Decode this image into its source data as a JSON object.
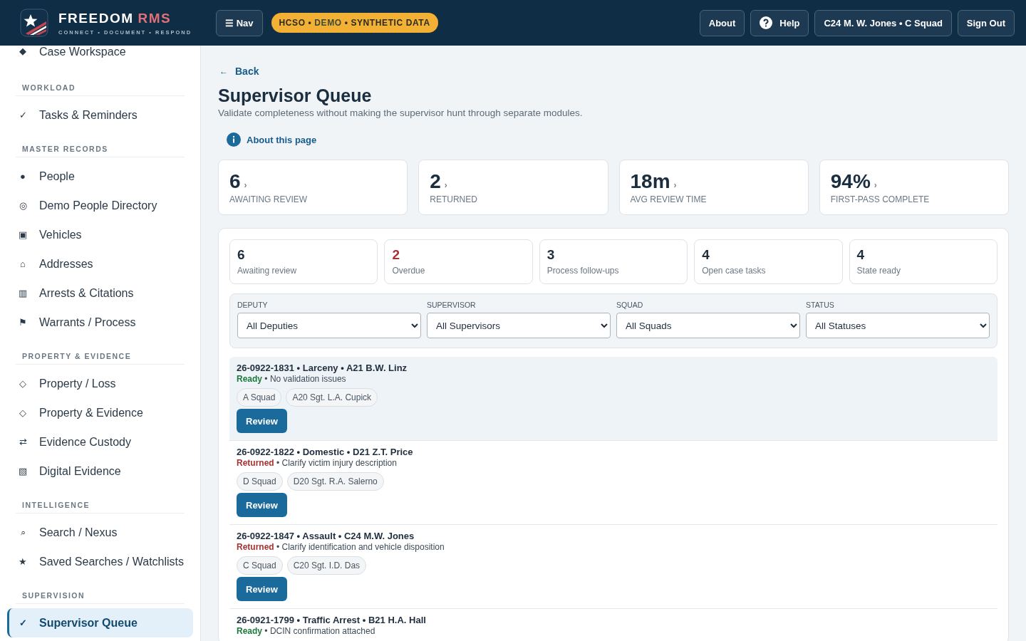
{
  "header": {
    "brand": "FREEDOM",
    "brand_accent": "RMS",
    "tagline": "CONNECT • DOCUMENT • RESPOND",
    "nav_button": "☰ Nav",
    "badge": {
      "parts": [
        "HCSO • ",
        "DEMO",
        " • SYNTHETIC DATA"
      ]
    },
    "buttons": [
      {
        "label": "About",
        "kind": "plain"
      },
      {
        "label": "Help",
        "kind": "help"
      },
      {
        "label": "C24 M. W. Jones • C Squad",
        "kind": "plain"
      },
      {
        "label": "Sign Out",
        "kind": "plain"
      }
    ]
  },
  "sidebar": {
    "sections": [
      {
        "items": [
          {
            "icon": "◆",
            "label": "Case Workspace",
            "selected": false
          }
        ]
      },
      {
        "title": "WORKLOAD",
        "items": [
          {
            "icon": "✓",
            "label": "Tasks & Reminders",
            "selected": false
          }
        ]
      },
      {
        "title": "MASTER RECORDS",
        "items": [
          {
            "icon": "●",
            "label": "People",
            "selected": false
          },
          {
            "icon": "◎",
            "label": "Demo People Directory",
            "selected": false
          },
          {
            "icon": "▣",
            "label": "Vehicles",
            "selected": false
          },
          {
            "icon": "⌂",
            "label": "Addresses",
            "selected": false
          },
          {
            "icon": "▥",
            "label": "Arrests & Citations",
            "selected": false
          },
          {
            "icon": "⚑",
            "label": "Warrants / Process",
            "selected": false
          }
        ]
      },
      {
        "title": "PROPERTY & EVIDENCE",
        "items": [
          {
            "icon": "◇",
            "label": "Property / Loss",
            "selected": false
          },
          {
            "icon": "◇",
            "label": "Property & Evidence",
            "selected": false
          },
          {
            "icon": "⇄",
            "label": "Evidence Custody",
            "selected": false
          },
          {
            "icon": "▧",
            "label": "Digital Evidence",
            "selected": false
          }
        ]
      },
      {
        "title": "INTELLIGENCE",
        "items": [
          {
            "icon": "⌕",
            "label": "Search / Nexus",
            "selected": false
          },
          {
            "icon": "★",
            "label": "Saved Searches / Watchlists",
            "selected": false
          }
        ]
      },
      {
        "title": "SUPERVISION",
        "items": [
          {
            "icon": "✓",
            "label": "Supervisor Queue",
            "selected": true
          }
        ]
      }
    ]
  },
  "page": {
    "back": "Back",
    "arrow": "←",
    "title": "Supervisor Queue",
    "subtitle": "Validate completeness without making the supervisor hunt through separate modules.",
    "about": "About this page"
  },
  "kpis": [
    {
      "value": "6",
      "chevron": "›",
      "label": "AWAITING REVIEW"
    },
    {
      "value": "2",
      "chevron": "›",
      "label": "RETURNED"
    },
    {
      "value": "18m",
      "chevron": "›",
      "label": "AVG REVIEW TIME"
    },
    {
      "value": "94%",
      "chevron": "›",
      "label": "FIRST-PASS COMPLETE"
    }
  ],
  "summary": [
    {
      "value": "6",
      "label": "Awaiting review",
      "kind": "normal"
    },
    {
      "value": "2",
      "label": "Overdue",
      "kind": "alert"
    },
    {
      "value": "3",
      "label": "Process follow-ups",
      "kind": "normal"
    },
    {
      "value": "4",
      "label": "Open case tasks",
      "kind": "normal"
    },
    {
      "value": "4",
      "label": "State ready",
      "kind": "normal"
    }
  ],
  "filters": [
    {
      "label": "DEPUTY",
      "value": "All Deputies"
    },
    {
      "label": "SUPERVISOR",
      "value": "All Supervisors"
    },
    {
      "label": "SQUAD",
      "value": "All Squads"
    },
    {
      "label": "STATUS",
      "value": "All Statuses"
    }
  ],
  "queue": [
    {
      "title": "26-0922-1831 • Larceny • A21 B.W. Linz",
      "status": {
        "label": "Ready",
        "color": "#1d7a3d"
      },
      "note": " • No validation issues",
      "tags": [
        "A Squad",
        "A20 Sgt. L.A. Cupick"
      ],
      "action": "Review",
      "selected": true
    },
    {
      "title": "26-0922-1822 • Domestic • D21 Z.T. Price",
      "status": {
        "label": "Returned",
        "color": "#a83232"
      },
      "note": " • Clarify victim injury description",
      "tags": [
        "D Squad",
        "D20 Sgt. R.A. Salerno"
      ],
      "action": "Review",
      "selected": false
    },
    {
      "title": "26-0922-1847 • Assault • C24 M.W. Jones",
      "status": {
        "label": "Returned",
        "color": "#a83232"
      },
      "note": " • Clarify identification and vehicle disposition",
      "tags": [
        "C Squad",
        "C20 Sgt. I.D. Das"
      ],
      "action": "Review",
      "selected": false
    },
    {
      "title": "26-0921-1799 • Traffic Arrest • B21 H.A. Hall",
      "status": {
        "label": "Ready",
        "color": "#1d7a3d"
      },
      "note": " • DCIN confirmation attached",
      "selected": false
    }
  ]
}
